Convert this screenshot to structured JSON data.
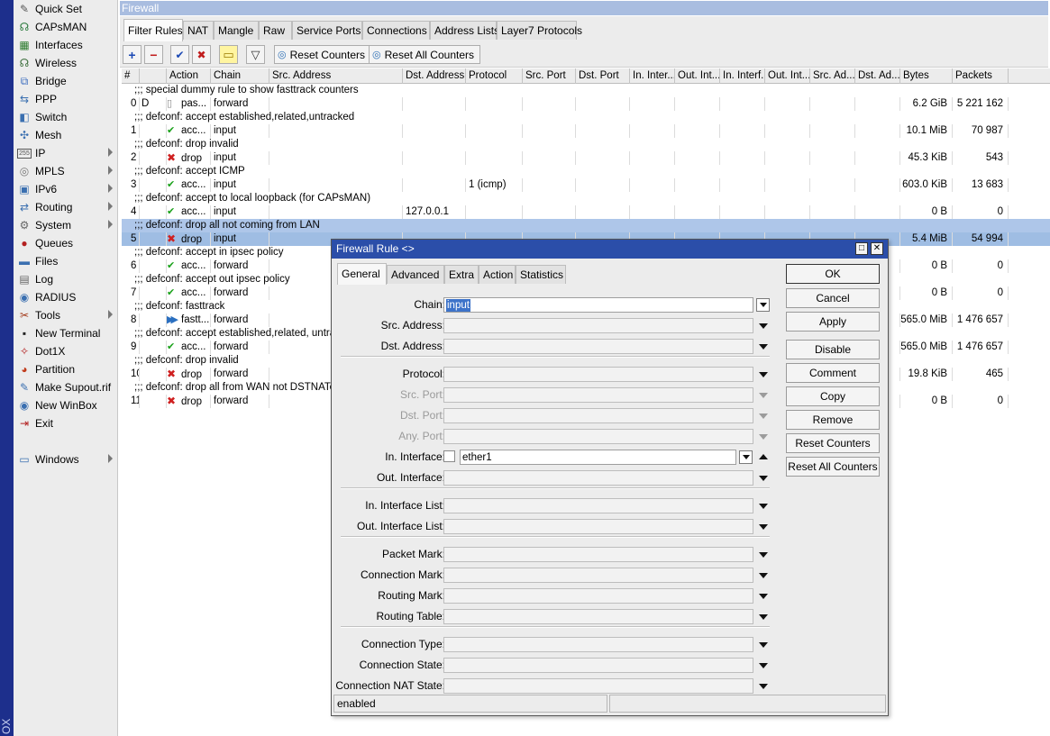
{
  "brand": "OX",
  "sidebar": {
    "items": [
      {
        "label": "Quick Set",
        "icon": "quick-set-icon",
        "glyph": "✎",
        "color": "#555555",
        "submenu": false
      },
      {
        "label": "CAPsMAN",
        "icon": "capsman-icon",
        "glyph": "☊",
        "color": "#2b7a3d",
        "submenu": false
      },
      {
        "label": "Interfaces",
        "icon": "interfaces-icon",
        "glyph": "▦",
        "color": "#2f7d32",
        "submenu": false
      },
      {
        "label": "Wireless",
        "icon": "wireless-icon",
        "glyph": "☊",
        "color": "#3b6d3b",
        "submenu": false
      },
      {
        "label": "Bridge",
        "icon": "bridge-icon",
        "glyph": "⧉",
        "color": "#3f6fbf",
        "submenu": false
      },
      {
        "label": "PPP",
        "icon": "ppp-icon",
        "glyph": "⇆",
        "color": "#3a6fb0",
        "submenu": false
      },
      {
        "label": "Switch",
        "icon": "switch-icon",
        "glyph": "◧",
        "color": "#3a6fb0",
        "submenu": false
      },
      {
        "label": "Mesh",
        "icon": "mesh-icon",
        "glyph": "✣",
        "color": "#3a6fb0",
        "submenu": false
      },
      {
        "label": "IP",
        "icon": "ip-icon",
        "glyph": "255",
        "color": "#555555",
        "submenu": true
      },
      {
        "label": "MPLS",
        "icon": "mpls-icon",
        "glyph": "◎",
        "color": "#777777",
        "submenu": true
      },
      {
        "label": "IPv6",
        "icon": "ipv6-icon",
        "glyph": "▣",
        "color": "#3a6fb0",
        "submenu": true
      },
      {
        "label": "Routing",
        "icon": "routing-icon",
        "glyph": "⇄",
        "color": "#3a6fb0",
        "submenu": true
      },
      {
        "label": "System",
        "icon": "system-icon",
        "glyph": "⚙",
        "color": "#666666",
        "submenu": true
      },
      {
        "label": "Queues",
        "icon": "queues-icon",
        "glyph": "●",
        "color": "#b32121",
        "submenu": false
      },
      {
        "label": "Files",
        "icon": "files-icon",
        "glyph": "▬",
        "color": "#3a6fb0",
        "submenu": false
      },
      {
        "label": "Log",
        "icon": "log-icon",
        "glyph": "▤",
        "color": "#666666",
        "submenu": false
      },
      {
        "label": "RADIUS",
        "icon": "radius-icon",
        "glyph": "◉",
        "color": "#3a6fb0",
        "submenu": false
      },
      {
        "label": "Tools",
        "icon": "tools-icon",
        "glyph": "✂",
        "color": "#a33a1a",
        "submenu": true
      },
      {
        "label": "New Terminal",
        "icon": "terminal-icon",
        "glyph": "▪",
        "color": "#222222",
        "submenu": false
      },
      {
        "label": "Dot1X",
        "icon": "dot1x-icon",
        "glyph": "✧",
        "color": "#b32121",
        "submenu": false
      },
      {
        "label": "Partition",
        "icon": "partition-icon",
        "glyph": "◕",
        "color": "#c03a1a",
        "submenu": false
      },
      {
        "label": "Make Supout.rif",
        "icon": "supout-icon",
        "glyph": "✎",
        "color": "#3a6fb0",
        "submenu": false
      },
      {
        "label": "New WinBox",
        "icon": "winbox-icon",
        "glyph": "◉",
        "color": "#3a6fb0",
        "submenu": false
      },
      {
        "label": "Exit",
        "icon": "exit-icon",
        "glyph": "⇥",
        "color": "#b32121",
        "submenu": false
      },
      {
        "label": "Windows",
        "icon": "windows-icon",
        "glyph": "▭",
        "color": "#3a6fb0",
        "submenu": true
      }
    ]
  },
  "window": {
    "title": "Firewall",
    "tabs": [
      "Filter Rules",
      "NAT",
      "Mangle",
      "Raw",
      "Service Ports",
      "Connections",
      "Address Lists",
      "Layer7 Protocols"
    ],
    "active_tab": "Filter Rules",
    "toolbar": {
      "add": "+",
      "remove": "−",
      "enable": "✔",
      "disable": "✖",
      "comment": "▭",
      "filter": "▽",
      "reset_counters": "Reset Counters",
      "reset_all_counters": "Reset All Counters"
    }
  },
  "table": {
    "columns": [
      "#",
      "",
      "Action",
      "Chain",
      "Src. Address",
      "Dst. Address",
      "Protocol",
      "Src. Port",
      "Dst. Port",
      "In. Inter...",
      "Out. Int...",
      "In. Interf...",
      "Out. Int...",
      "Src. Ad...",
      "Dst. Ad...",
      "Bytes",
      "Packets"
    ],
    "rows": [
      {
        "kind": "comment",
        "text": ";;; special dummy rule to show fasttrack counters"
      },
      {
        "kind": "rule",
        "num": "0",
        "flag": "D",
        "icon": "dummy",
        "action": "pas...",
        "chain": "forward",
        "src": "",
        "dst": "",
        "proto": "",
        "inif": "",
        "bytes": "6.2 GiB",
        "packets": "5 221 162"
      },
      {
        "kind": "comment",
        "text": ";;; defconf: accept established,related,untracked"
      },
      {
        "kind": "rule",
        "num": "1",
        "flag": "",
        "icon": "accept",
        "action": "acc...",
        "chain": "input",
        "src": "",
        "dst": "",
        "proto": "",
        "inif": "",
        "bytes": "10.1 MiB",
        "packets": "70 987"
      },
      {
        "kind": "comment",
        "text": ";;; defconf: drop invalid"
      },
      {
        "kind": "rule",
        "num": "2",
        "flag": "",
        "icon": "drop",
        "action": "drop",
        "chain": "input",
        "src": "",
        "dst": "",
        "proto": "",
        "inif": "",
        "bytes": "45.3 KiB",
        "packets": "543"
      },
      {
        "kind": "comment",
        "text": ";;; defconf: accept ICMP"
      },
      {
        "kind": "rule",
        "num": "3",
        "flag": "",
        "icon": "accept",
        "action": "acc...",
        "chain": "input",
        "src": "",
        "dst": "",
        "proto": "1 (icmp)",
        "inif": "",
        "bytes": "603.0 KiB",
        "packets": "13 683"
      },
      {
        "kind": "comment",
        "text": ";;; defconf: accept to local loopback (for CAPsMAN)"
      },
      {
        "kind": "rule",
        "num": "4",
        "flag": "",
        "icon": "accept",
        "action": "acc...",
        "chain": "input",
        "src": "",
        "dst": "127.0.0.1",
        "proto": "",
        "inif": "",
        "bytes": "0 B",
        "packets": "0"
      },
      {
        "kind": "comment",
        "text": ";;; defconf: drop all not coming from LAN",
        "selected": true
      },
      {
        "kind": "rule",
        "num": "5",
        "flag": "",
        "icon": "drop",
        "action": "drop",
        "chain": "input",
        "src": "",
        "dst": "",
        "proto": "",
        "inif": "",
        "bytes": "5.4 MiB",
        "packets": "54 994",
        "selected": true
      },
      {
        "kind": "comment",
        "text": ";;; defconf: accept in ipsec policy"
      },
      {
        "kind": "rule",
        "num": "6",
        "flag": "",
        "icon": "accept",
        "action": "acc...",
        "chain": "forward",
        "src": "",
        "dst": "",
        "proto": "",
        "inif": "",
        "bytes": "0 B",
        "packets": "0"
      },
      {
        "kind": "comment",
        "text": ";;; defconf: accept out ipsec policy"
      },
      {
        "kind": "rule",
        "num": "7",
        "flag": "",
        "icon": "accept",
        "action": "acc...",
        "chain": "forward",
        "src": "",
        "dst": "",
        "proto": "",
        "inif": "",
        "bytes": "0 B",
        "packets": "0"
      },
      {
        "kind": "comment",
        "text": ";;; defconf: fasttrack"
      },
      {
        "kind": "rule",
        "num": "8",
        "flag": "",
        "icon": "fasttrack",
        "action": "fastt...",
        "chain": "forward",
        "src": "",
        "dst": "",
        "proto": "",
        "inif": "",
        "bytes": "565.0 MiB",
        "packets": "1 476 657"
      },
      {
        "kind": "comment",
        "text": ";;; defconf: accept established,related, untrack"
      },
      {
        "kind": "rule",
        "num": "9",
        "flag": "",
        "icon": "accept",
        "action": "acc...",
        "chain": "forward",
        "src": "",
        "dst": "",
        "proto": "",
        "inif": "",
        "bytes": "565.0 MiB",
        "packets": "1 476 657"
      },
      {
        "kind": "comment",
        "text": ";;; defconf: drop invalid"
      },
      {
        "kind": "rule",
        "num": "10",
        "flag": "",
        "icon": "drop",
        "action": "drop",
        "chain": "forward",
        "src": "",
        "dst": "",
        "proto": "",
        "inif": "",
        "bytes": "19.8 KiB",
        "packets": "465"
      },
      {
        "kind": "comment",
        "text": ";;; defconf: drop all from WAN not DSTNATed"
      },
      {
        "kind": "rule",
        "num": "11",
        "flag": "",
        "icon": "drop",
        "action": "drop",
        "chain": "forward",
        "src": "",
        "dst": "",
        "proto": "",
        "inif": "",
        "bytes": "0 B",
        "packets": "0"
      }
    ]
  },
  "dialog": {
    "title": "Firewall Rule <>",
    "tabs": [
      "General",
      "Advanced",
      "Extra",
      "Action",
      "Statistics"
    ],
    "active_tab": "General",
    "fields": [
      {
        "label": "Chain:",
        "value": "input",
        "disabled": false,
        "style": "combo",
        "selected": true
      },
      {
        "label": "Src. Address:",
        "value": "",
        "disabled": false,
        "style": "drop"
      },
      {
        "label": "Dst. Address:",
        "value": "",
        "disabled": false,
        "style": "drop"
      },
      {
        "label": "Protocol:",
        "value": "",
        "disabled": false,
        "style": "drop"
      },
      {
        "label": "Src. Port:",
        "value": "",
        "disabled": true,
        "style": "drop"
      },
      {
        "label": "Dst. Port:",
        "value": "",
        "disabled": true,
        "style": "drop"
      },
      {
        "label": "Any. Port:",
        "value": "",
        "disabled": true,
        "style": "drop"
      },
      {
        "label": "In. Interface:",
        "value": "ether1",
        "disabled": false,
        "style": "check-combo"
      },
      {
        "label": "Out. Interface:",
        "value": "",
        "disabled": false,
        "style": "drop"
      },
      {
        "label": "In. Interface List:",
        "value": "",
        "disabled": false,
        "style": "drop"
      },
      {
        "label": "Out. Interface List:",
        "value": "",
        "disabled": false,
        "style": "drop"
      },
      {
        "label": "Packet Mark:",
        "value": "",
        "disabled": false,
        "style": "drop"
      },
      {
        "label": "Connection Mark:",
        "value": "",
        "disabled": false,
        "style": "drop"
      },
      {
        "label": "Routing Mark:",
        "value": "",
        "disabled": false,
        "style": "drop"
      },
      {
        "label": "Routing Table:",
        "value": "",
        "disabled": false,
        "style": "drop"
      },
      {
        "label": "Connection Type:",
        "value": "",
        "disabled": false,
        "style": "drop"
      },
      {
        "label": "Connection State:",
        "value": "",
        "disabled": false,
        "style": "drop"
      },
      {
        "label": "Connection NAT State:",
        "value": "",
        "disabled": false,
        "style": "drop"
      }
    ],
    "buttons": [
      "OK",
      "Cancel",
      "Apply",
      "Disable",
      "Comment",
      "Copy",
      "Remove",
      "Reset Counters",
      "Reset All Counters"
    ],
    "status": "enabled",
    "status_right": "",
    "title_buttons": {
      "maximize": "□",
      "close": "✕"
    }
  }
}
